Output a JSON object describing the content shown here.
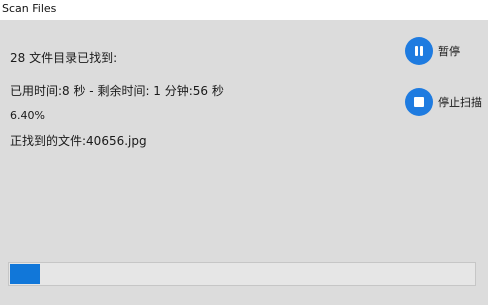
{
  "window": {
    "title": "Scan Files"
  },
  "status": {
    "found": "28 文件目录已找到:",
    "time": "已用时间:8 秒 - 剩余时间: 1 分钟:56 秒",
    "percent_text": "6.40%",
    "current_file": "正找到的文件:40656.jpg"
  },
  "actions": {
    "pause_label": "暂停",
    "stop_label": "停止扫描",
    "pause_icon": "pause-icon",
    "stop_icon": "stop-icon"
  },
  "progress": {
    "value_percent": 6.4
  },
  "colors": {
    "accent": "#1e7be0",
    "progress_fill": "#1177d9",
    "panel_background": "#dcdcdc"
  }
}
